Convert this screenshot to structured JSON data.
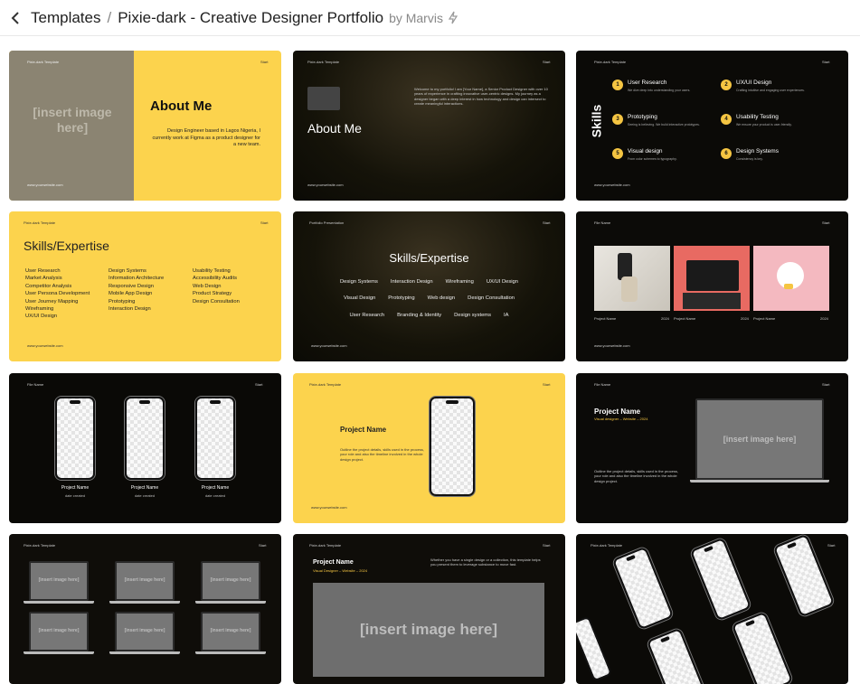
{
  "header": {
    "back_label": "<",
    "crumb1": "Templates",
    "separator": "/",
    "crumb2": "Pixie-dark - Creative Designer Portfolio",
    "by": "by Marvis"
  },
  "common": {
    "brand": "Pixie-dark Template",
    "start": "Start",
    "website": "www.yourwebsite.com",
    "portfolio": "Portfolio Presentation",
    "file_name": "File Name"
  },
  "s1": {
    "ph": "[insert image here]",
    "title": "About Me",
    "body": "Design Engineer based in Lagos Nigeria, I currently work at Figma as a product designer for a new team."
  },
  "s2": {
    "title": "About Me",
    "body": "Welcome to my portfolio! I am [Your Name], a Senior Product Designer with over 10 years of experience in crafting innovative user-centric designs. My journey as a designer began with a deep interest in how technology and design can intersect to create meaningful interactions."
  },
  "s3": {
    "title": "Skills",
    "items": [
      {
        "n": "1",
        "t": "User Research",
        "d": "We dive deep into understanding your users."
      },
      {
        "n": "2",
        "t": "UX/UI Design",
        "d": "Crafting intuitive and engaging user experiences."
      },
      {
        "n": "3",
        "t": "Prototyping",
        "d": "Seeing is believing. We build interactive prototypes."
      },
      {
        "n": "4",
        "t": "Usability Testing",
        "d": "We ensure your product is user-friendly."
      },
      {
        "n": "5",
        "t": "Visual design",
        "d": "From color schemes to typography."
      },
      {
        "n": "6",
        "t": "Design Systems",
        "d": "Consistency is key."
      }
    ]
  },
  "s4": {
    "title": "Skills/Expertise",
    "col1": [
      "User Research",
      "Market Analysis",
      "Competitor Analysis",
      "User Persona Development",
      "User Journey Mapping",
      "Wireframing",
      "UX/UI Design"
    ],
    "col2": [
      "Design Systems",
      "Information Architecture",
      "Responsive Design",
      "Mobile App Design",
      "Prototyping",
      "Interaction Design"
    ],
    "col3": [
      "Usability Testing",
      "Accessibility Audits",
      "Web Design",
      "Product Strategy",
      "Design Consultation"
    ]
  },
  "s5": {
    "title": "Skills/Expertise",
    "row1": [
      "Design Systems",
      "Interaction Design",
      "Wireframing",
      "UX/UI Design"
    ],
    "row2": [
      "Visual Design",
      "Prototyping",
      "Web design",
      "Design Consultation"
    ],
    "row3": [
      "User Research",
      "Branding & Identity",
      "Design systems",
      "IA"
    ]
  },
  "s6": {
    "captions": [
      "Project Name",
      "2024",
      "Project Name",
      "2024",
      "Project Name",
      "2024"
    ]
  },
  "s7": {
    "name": "Project Name",
    "date": "date created"
  },
  "s8": {
    "title": "Project Name",
    "body": "Outline the project details, skills used in the process, your role and also the timeline involved in the whole design project."
  },
  "s9": {
    "title": "Project Name",
    "sub": "Visual designer – Website – 2024",
    "body": "Outline the project details, skills used in the process, your role and also the timeline involved in the whole design project.",
    "ph": "[insert image here]"
  },
  "s10": {
    "ph": "[insert image here]"
  },
  "s11": {
    "title": "Project Name",
    "sub": "Visual Designer – Website – 2024",
    "body": "Whether you have a single design or a collection, this template helps you present them to leverage substance to move fast.",
    "ph": "[insert image here]"
  }
}
